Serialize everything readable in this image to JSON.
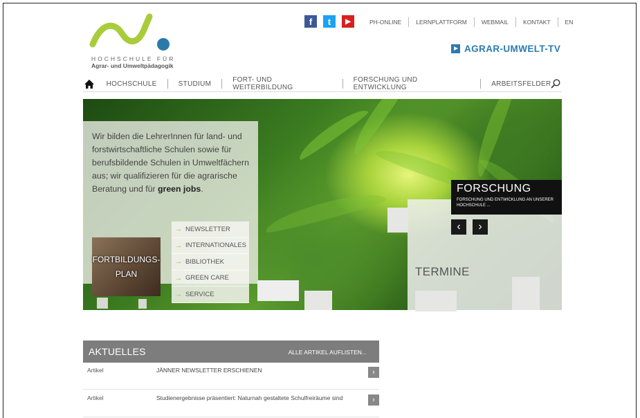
{
  "logo": {
    "line1": "HOCHSCHULE FÜR",
    "line2": "Agrar- und Umweltpädagogik",
    "colors": {
      "green": "#a8cc3a",
      "blue": "#2a7aa8"
    }
  },
  "social": [
    {
      "name": "facebook-icon",
      "glyph": "f",
      "color": "#3b5998"
    },
    {
      "name": "twitter-icon",
      "glyph": "t",
      "color": "#1da1f2"
    },
    {
      "name": "youtube-icon",
      "glyph": "▶",
      "color": "#d92020"
    }
  ],
  "toplinks": [
    "PH-ONLINE",
    "LERNPLATTFORM",
    "WEBMAIL",
    "KONTAKT",
    "EN"
  ],
  "agrartv": "AGRAR-UMWELT-TV",
  "nav": {
    "items": [
      "HOCHSCHULE",
      "STUDIUM",
      "FORT- UND WEITERBILDUNG",
      "FORSCHUNG UND ENTWICKLUNG",
      "ARBEITSFELDER"
    ]
  },
  "hero": {
    "intro_prefix": "Wir bilden die LehrerInnen für land- und forstwirtschaftliche Schulen sowie für berufsbildende Schulen in Umweltfächern aus; wir qualifizieren für die agrarische Beratung und für ",
    "intro_bold": "green jobs",
    "intro_suffix": ".",
    "fortbildung_line1": "FORTBILDUNGS-",
    "fortbildung_line2": "PLAN",
    "quicklinks": [
      "NEWSLETTER",
      "INTERNATIONALES",
      "BIBLIOTHEK",
      "GREEN CARE",
      "SERVICE"
    ],
    "forschung_title": "FORSCHUNG",
    "forschung_sub": "FORSCHUNG UND ENTWICKLUNG AN UNSERER HOCHSCHULE ...",
    "prev": "‹",
    "next": "›",
    "termine": "TERMINE"
  },
  "news": {
    "title": "AKTUELLES",
    "all_link": "ALLE ARTIKEL AUFLISTEN...",
    "rows": [
      {
        "kind": "Artikel",
        "text": "JÄNNER NEWSLETTER ERSCHIENEN"
      },
      {
        "kind": "Artikel",
        "text": "Studienergebnisse präsentiert: Naturnah gestaltete Schulfreiräume sind"
      }
    ]
  }
}
